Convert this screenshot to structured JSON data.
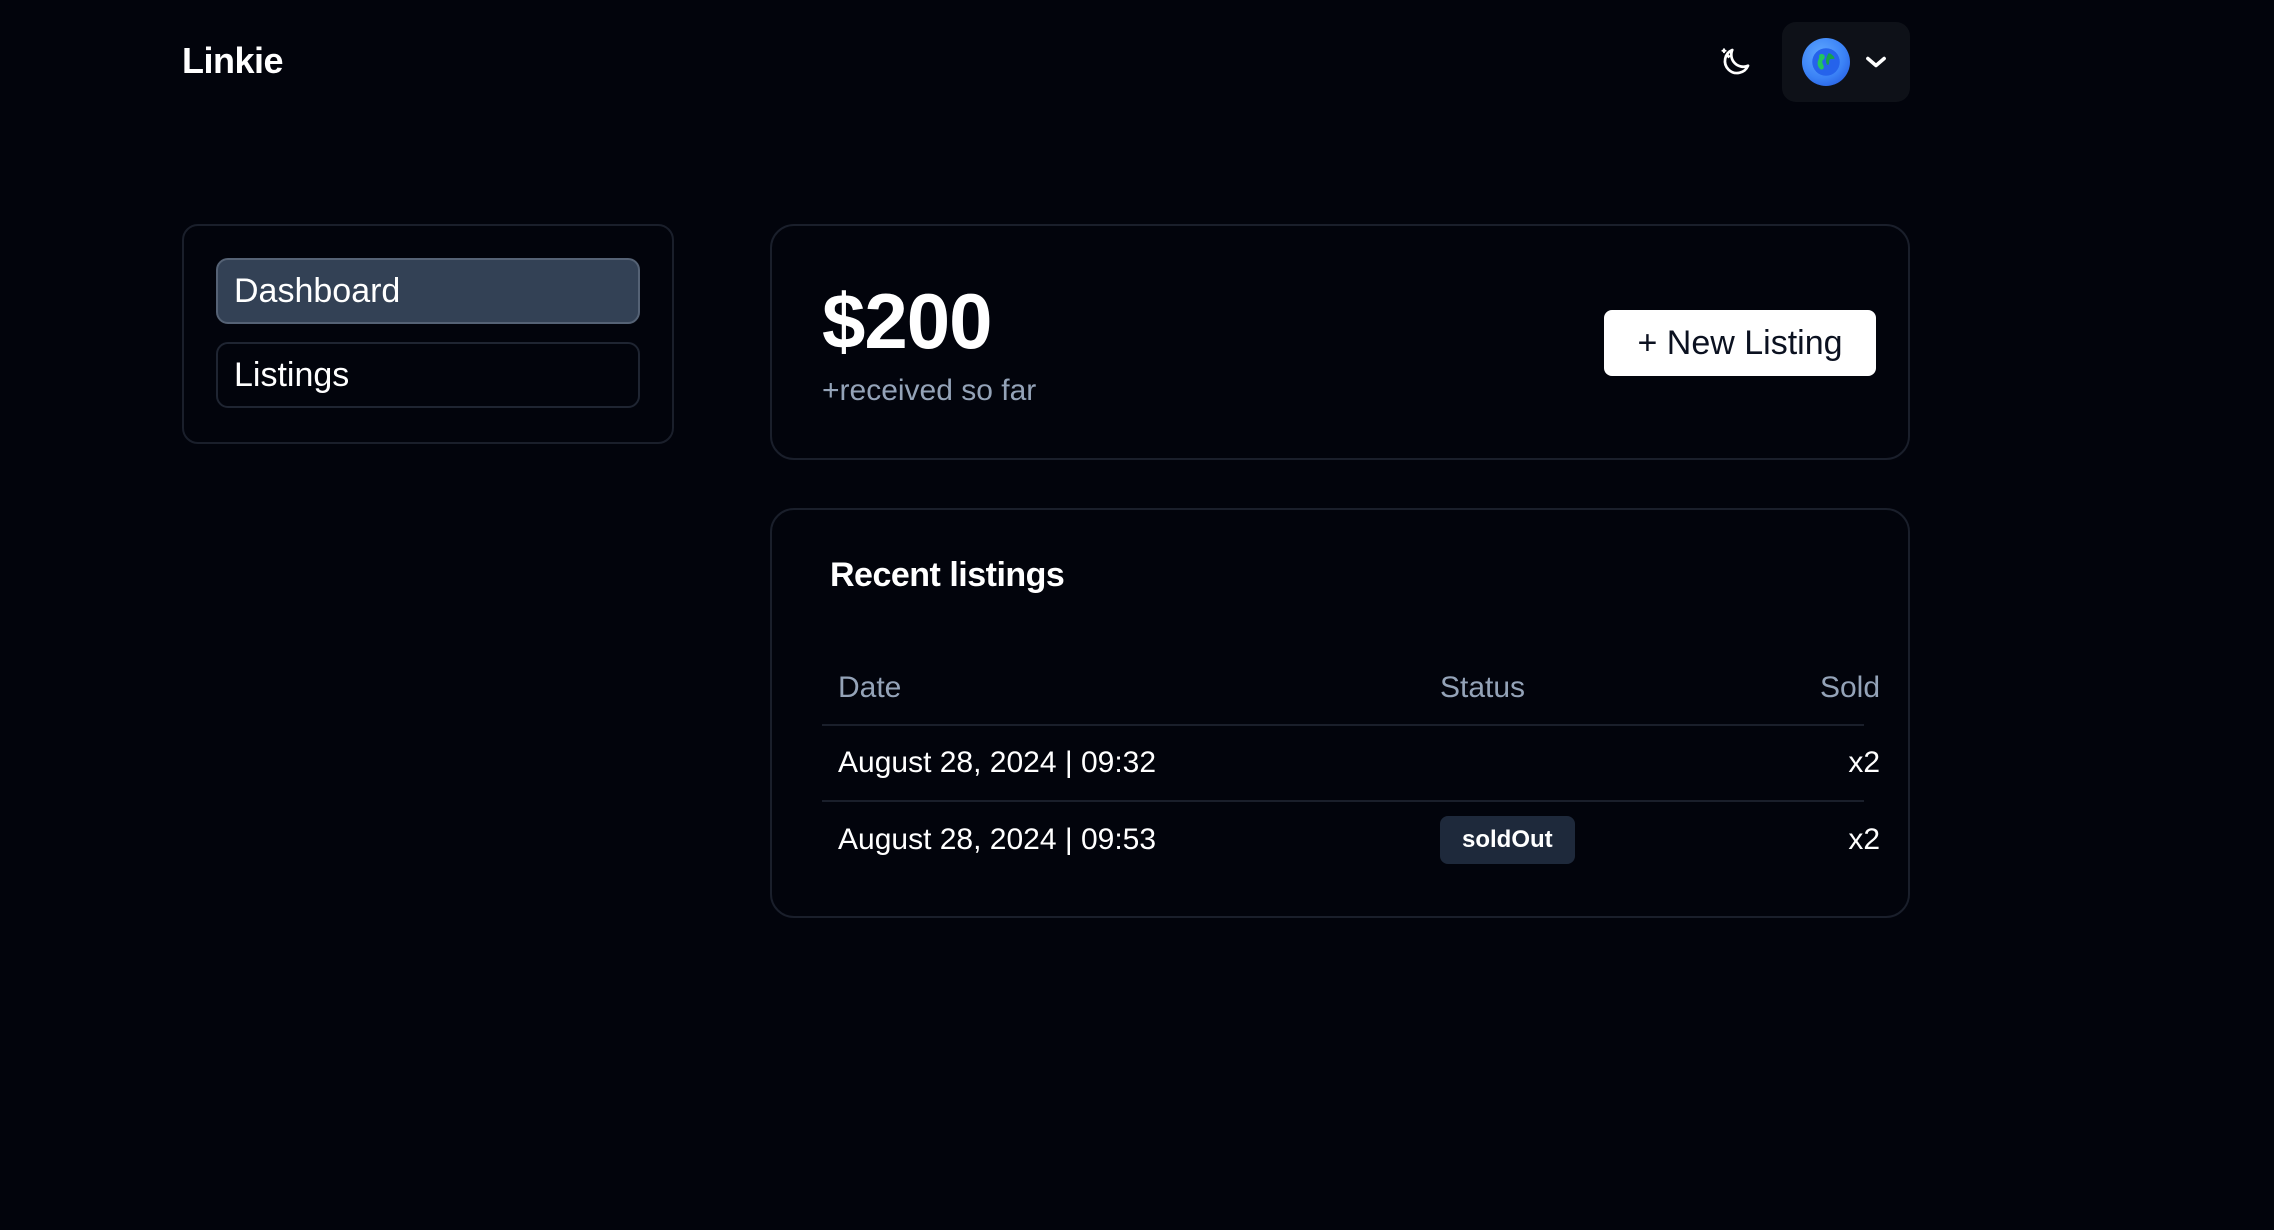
{
  "header": {
    "brand": "Linkie",
    "theme_toggle_icon": "moon-icon",
    "language_icon": "globe-icon",
    "dropdown_icon": "chevron-down-icon"
  },
  "sidebar": {
    "items": [
      {
        "label": "Dashboard",
        "active": true
      },
      {
        "label": "Listings",
        "active": false
      }
    ]
  },
  "summary": {
    "amount": "$200",
    "subtitle": "+received so far",
    "new_listing_label": "+ New Listing"
  },
  "recent": {
    "title": "Recent listings",
    "columns": [
      "Date",
      "Status",
      "Sold"
    ],
    "rows": [
      {
        "date": "August 28, 2024 | 09:32",
        "status": "",
        "sold": "x2"
      },
      {
        "date": "August 28, 2024 | 09:53",
        "status": "soldOut",
        "sold": "x2"
      }
    ]
  }
}
